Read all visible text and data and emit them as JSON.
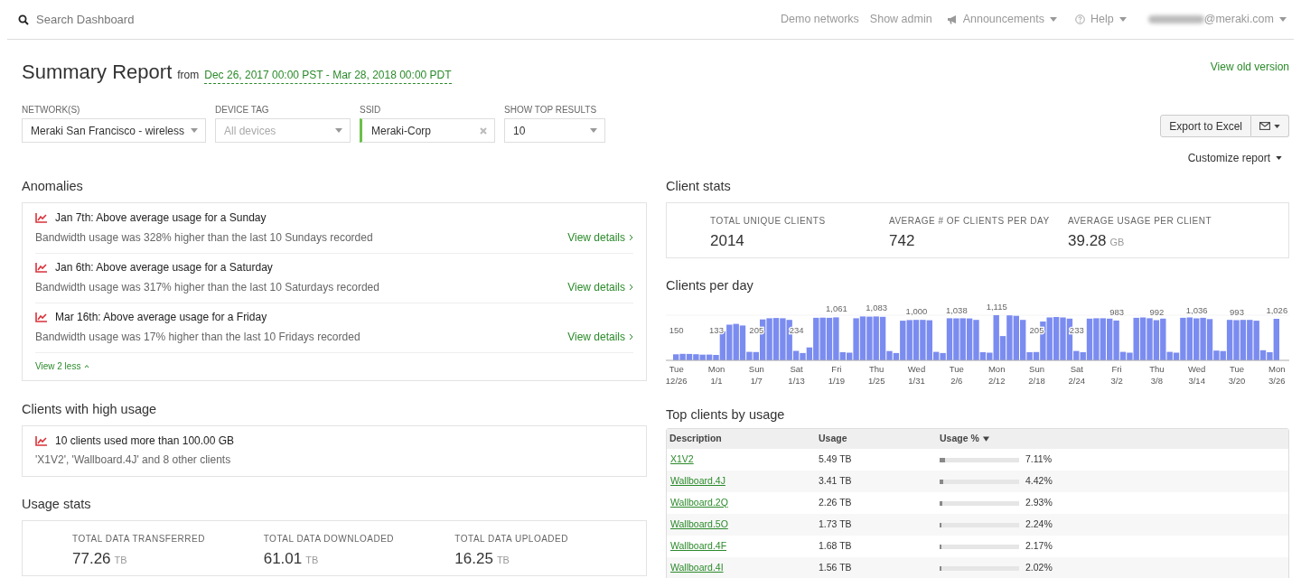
{
  "top_bar": {
    "search": {
      "placeholder": "Search Dashboard"
    },
    "links": [
      {
        "label": "Demo networks",
        "kind": "link"
      },
      {
        "label": "Show admin",
        "kind": "link"
      },
      {
        "label": "Announcements",
        "kind": "announce"
      },
      {
        "label": "Help",
        "kind": "help"
      },
      {
        "label": "@meraki.com",
        "kind": "account"
      }
    ]
  },
  "header": {
    "title": "Summary Report",
    "from_label": "from",
    "date_range": "Dec 26, 2017 00:00 PST - Mar 28, 2018 00:00 PDT",
    "view_old": "View old version"
  },
  "filters": [
    {
      "label": "NETWORK(S)",
      "value": "Meraki San Francisco - wireless",
      "kind": "select"
    },
    {
      "label": "DEVICE TAG",
      "placeholder": "All devices",
      "kind": "select"
    },
    {
      "label": "SSID",
      "value": "Meraki-Corp",
      "kind": "tag"
    },
    {
      "label": "SHOW TOP RESULTS",
      "value": "10",
      "kind": "select"
    }
  ],
  "export_button": "Export to Excel",
  "customize_report": "Customize report",
  "anomalies": {
    "title": "Anomalies",
    "items": [
      {
        "title": "Jan 7th: Above average usage for a Sunday",
        "description": "Bandwidth usage was 328% higher than the last 10 Sundays recorded",
        "link": "View details"
      },
      {
        "title": "Jan 6th: Above average usage for a Saturday",
        "description": "Bandwidth usage was 317% higher than the last 10 Saturdays recorded",
        "link": "View details"
      },
      {
        "title": "Mar 16th: Above average usage for a Friday",
        "description": "Bandwidth usage was 17% higher than the last 10 Fridays recorded",
        "link": "View details"
      }
    ],
    "toggle": "View 2 less"
  },
  "high_usage": {
    "title": "Clients with high usage",
    "headline": "10 clients used more than 100.00 GB",
    "detail": "'X1V2', 'Wallboard.4J' and 8 other clients"
  },
  "usage_stats": {
    "title": "Usage stats",
    "stats": [
      {
        "label": "TOTAL DATA TRANSFERRED",
        "value": "77.26",
        "unit": "TB"
      },
      {
        "label": "TOTAL DATA DOWNLOADED",
        "value": "61.01",
        "unit": "TB"
      },
      {
        "label": "TOTAL DATA UPLOADED",
        "value": "16.25",
        "unit": "TB"
      }
    ]
  },
  "client_stats": {
    "title": "Client stats",
    "stats": [
      {
        "label": "TOTAL UNIQUE CLIENTS",
        "value": "2014"
      },
      {
        "label": "AVERAGE # OF CLIENTS PER DAY",
        "value": "742"
      },
      {
        "label": "AVERAGE USAGE PER CLIENT",
        "value": "39.28",
        "unit": "GB"
      }
    ]
  },
  "clients_per_day": {
    "title": "Clients per day",
    "chart_data": {
      "type": "bar",
      "color": "#7b8cf0",
      "values": [
        150,
        160,
        158,
        152,
        140,
        142,
        133,
        720,
        880,
        900,
        860,
        210,
        205,
        1010,
        1040,
        1045,
        1040,
        1000,
        234,
        180,
        320,
        1050,
        1055,
        1050,
        1061,
        200,
        190,
        1040,
        1083,
        1080,
        1083,
        1075,
        230,
        180,
        980,
        995,
        1000,
        1000,
        990,
        210,
        180,
        1040,
        1038,
        1040,
        1035,
        1000,
        200,
        190,
        1115,
        600,
        1110,
        1100,
        1000,
        200,
        205,
        960,
        1060,
        1070,
        1060,
        1030,
        233,
        200,
        1030,
        1040,
        1040,
        1030,
        983,
        210,
        190,
        1050,
        1060,
        1040,
        992,
        1030,
        210,
        190,
        1050,
        1060,
        1036,
        1050,
        1020,
        240,
        230,
        1000,
        993,
        1000,
        1000,
        980,
        250,
        200,
        1026
      ],
      "value_labels": [
        "150",
        null,
        null,
        null,
        null,
        null,
        "133",
        null,
        null,
        null,
        null,
        null,
        "205",
        null,
        null,
        null,
        null,
        null,
        "234",
        null,
        null,
        null,
        null,
        null,
        "1,061",
        null,
        null,
        null,
        null,
        null,
        "1,083",
        null,
        null,
        null,
        null,
        null,
        "1,000",
        null,
        null,
        null,
        null,
        null,
        "1,038",
        null,
        null,
        null,
        null,
        null,
        "1,115",
        null,
        null,
        null,
        null,
        null,
        "205",
        null,
        null,
        null,
        null,
        null,
        "233",
        null,
        null,
        null,
        null,
        null,
        "983",
        null,
        null,
        null,
        null,
        null,
        "992",
        null,
        null,
        null,
        null,
        null,
        "1,036",
        null,
        null,
        null,
        null,
        null,
        "993",
        null,
        null,
        null,
        null,
        null,
        "1,026"
      ],
      "categories": [
        "Tue\n12/26",
        null,
        null,
        null,
        null,
        null,
        "Mon\n1/1",
        null,
        null,
        null,
        null,
        null,
        "Sun\n1/7",
        null,
        null,
        null,
        null,
        null,
        "Sat\n1/13",
        null,
        null,
        null,
        null,
        null,
        "Fri\n1/19",
        null,
        null,
        null,
        null,
        null,
        "Thu\n1/25",
        null,
        null,
        null,
        null,
        null,
        "Wed\n1/31",
        null,
        null,
        null,
        null,
        null,
        "Tue\n2/6",
        null,
        null,
        null,
        null,
        null,
        "Mon\n2/12",
        null,
        null,
        null,
        null,
        null,
        "Sun\n2/18",
        null,
        null,
        null,
        null,
        null,
        "Sat\n2/24",
        null,
        null,
        null,
        null,
        null,
        "Fri\n3/2",
        null,
        null,
        null,
        null,
        null,
        "Thu\n3/8",
        null,
        null,
        null,
        null,
        null,
        "Wed\n3/14",
        null,
        null,
        null,
        null,
        null,
        "Tue\n3/20",
        null,
        null,
        null,
        null,
        null,
        "Mon\n3/26"
      ]
    }
  },
  "top_clients": {
    "title": "Top clients by usage",
    "columns": [
      {
        "label": "Description",
        "sorted": false
      },
      {
        "label": "Usage",
        "sorted": false
      },
      {
        "label": "Usage %",
        "sorted": true
      }
    ],
    "rows": [
      {
        "description": "X1V2",
        "usage": "5.49 TB",
        "level": 0.0711,
        "percent": "7.11%"
      },
      {
        "description": "Wallboard.4J",
        "usage": "3.41 TB",
        "level": 0.0442,
        "percent": "4.42%"
      },
      {
        "description": "Wallboard.2Q",
        "usage": "2.26 TB",
        "level": 0.0293,
        "percent": "2.93%"
      },
      {
        "description": "Wallboard.5O",
        "usage": "1.73 TB",
        "level": 0.0224,
        "percent": "2.24%"
      },
      {
        "description": "Wallboard.4F",
        "usage": "1.68 TB",
        "level": 0.0217,
        "percent": "2.17%"
      },
      {
        "description": "Wallboard.4I",
        "usage": "1.56 TB",
        "level": 0.0202,
        "percent": "2.02%"
      }
    ]
  }
}
